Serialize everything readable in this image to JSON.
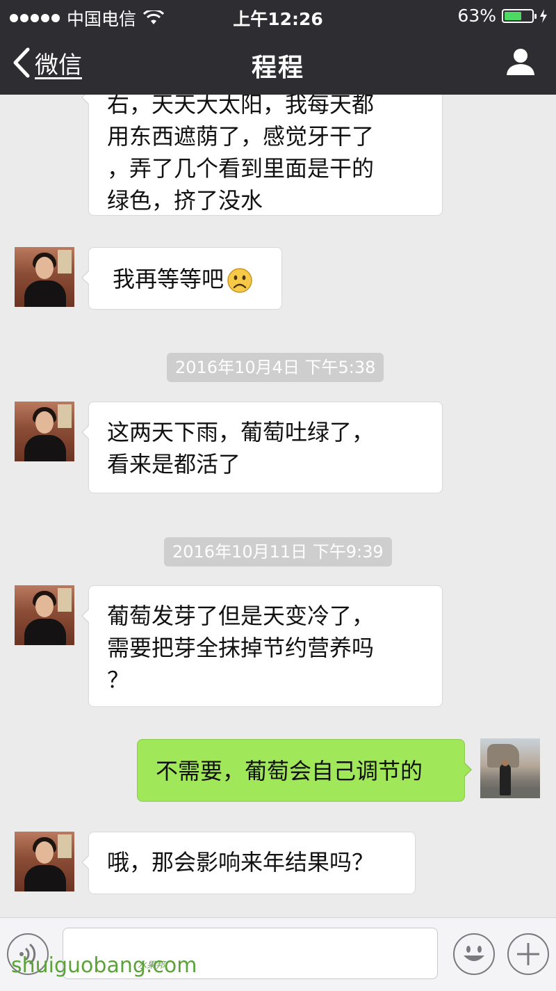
{
  "status_bar": {
    "carrier": "中国电信",
    "time": "上午12:26",
    "battery_percent": "63%",
    "battery_level": 0.63,
    "battery_color": "#4cd964"
  },
  "nav": {
    "back_label": "微信",
    "title": "程程",
    "back_icon": "chevron-left-icon",
    "profile_icon": "person-icon"
  },
  "messages": [
    {
      "side": "left",
      "text_lines": [
        "右，天天大太阳，我每天都",
        "用东西遮荫了，感觉牙干了",
        "，弄了几个看到里面是干的",
        "绿色，挤了没水"
      ]
    },
    {
      "side": "left",
      "text": "我再等等吧",
      "emoji": "sad-face-emoji"
    },
    {
      "timestamp": "2016年10月4日 下午5:38"
    },
    {
      "side": "left",
      "text_lines": [
        "这两天下雨，葡萄吐绿了，",
        "看来是都活了"
      ]
    },
    {
      "timestamp": "2016年10月11日 下午9:39"
    },
    {
      "side": "left",
      "text_lines": [
        "葡萄发芽了但是天变冷了，",
        "需要把芽全抹掉节约营养吗",
        "？"
      ]
    },
    {
      "side": "right",
      "text": "不需要，葡萄会自己调节的"
    },
    {
      "side": "left",
      "text": "哦，那会影响来年结果吗？"
    }
  ],
  "input_bar": {
    "voice_icon": "voice-icon",
    "emoji_icon": "smiley-icon",
    "plus_icon": "plus-icon"
  },
  "watermark": {
    "text": "shuiguobang.com",
    "chinese": "水果邦"
  },
  "colors": {
    "nav_bg": "#2e2d32",
    "chat_bg": "#ebebeb",
    "outgoing_bubble": "#a0e75a",
    "incoming_bubble": "#ffffff",
    "timestamp_bg": "#cecece"
  }
}
